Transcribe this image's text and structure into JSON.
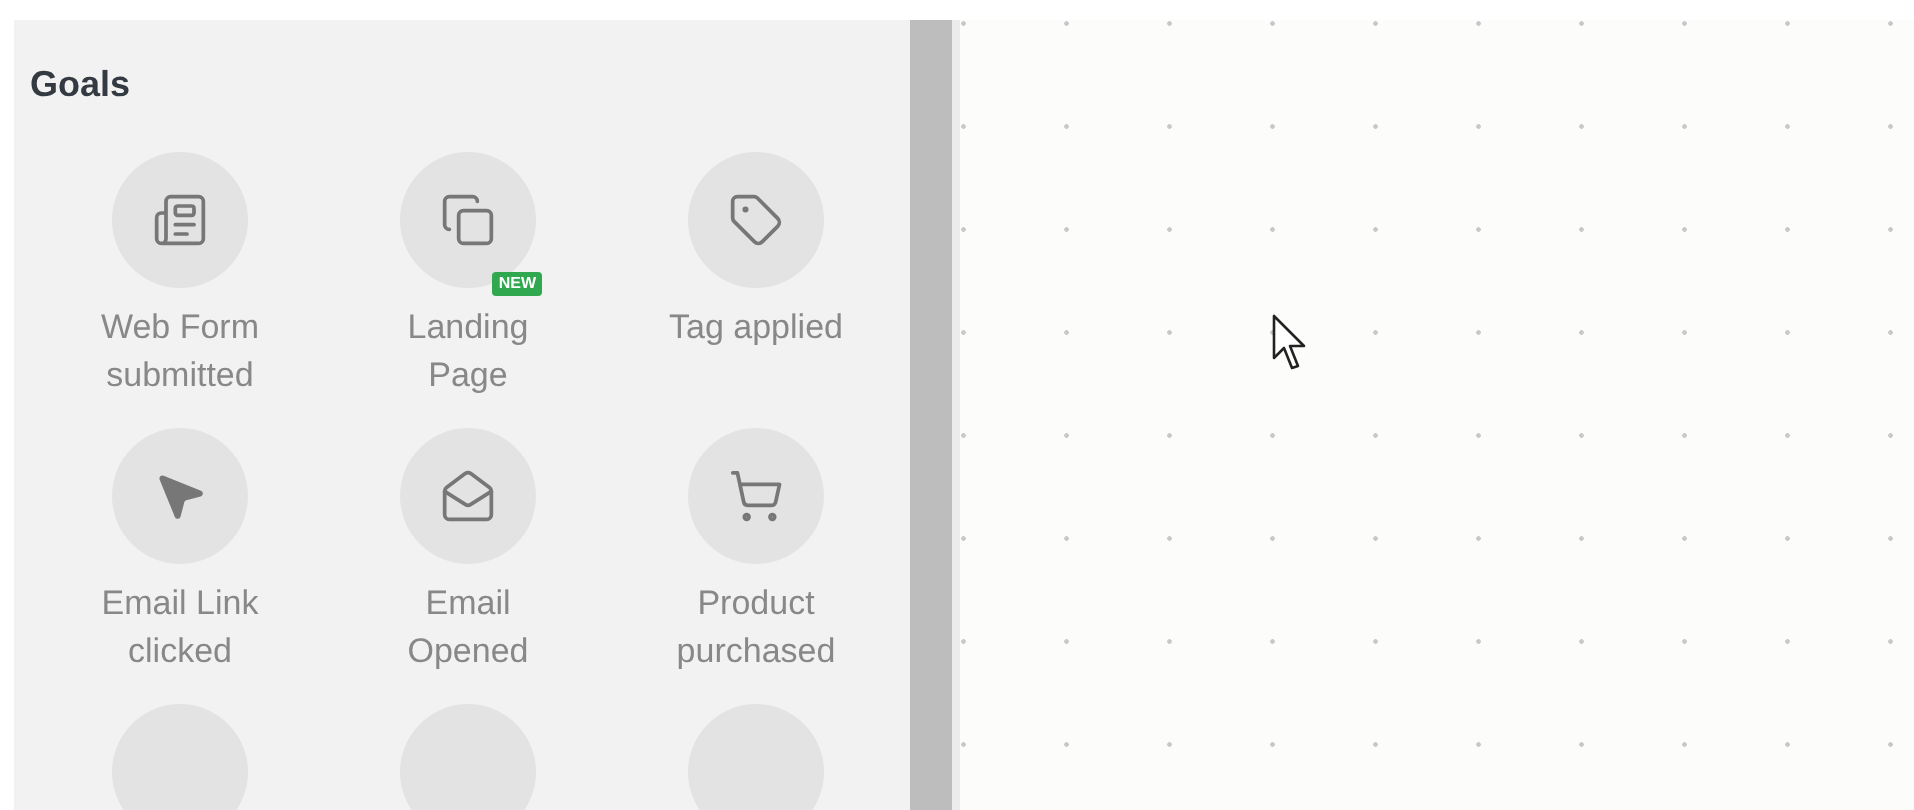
{
  "panel": {
    "title": "Goals"
  },
  "goals": [
    {
      "label": "Web Form submitted"
    },
    {
      "label": "Landing Page",
      "badge": "NEW"
    },
    {
      "label": "Tag applied"
    },
    {
      "label": "Email Link clicked"
    },
    {
      "label": "Email Opened"
    },
    {
      "label": "Product purchased"
    }
  ]
}
